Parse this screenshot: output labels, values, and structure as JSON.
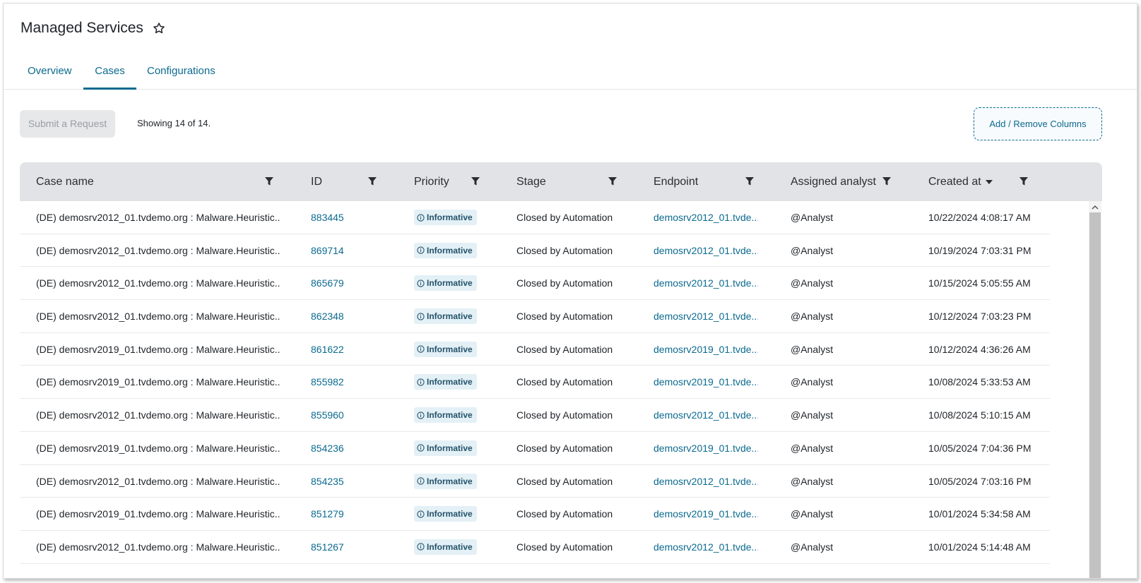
{
  "page": {
    "title": "Managed Services"
  },
  "tabs": [
    {
      "label": "Overview",
      "active": false
    },
    {
      "label": "Cases",
      "active": true
    },
    {
      "label": "Configurations",
      "active": false
    }
  ],
  "toolbar": {
    "submit_label": "Submit a Request",
    "showing_text": "Showing 14 of 14.",
    "add_columns_label": "Add / Remove Columns"
  },
  "table": {
    "columns": [
      "Case name",
      "ID",
      "Priority",
      "Stage",
      "Endpoint",
      "Assigned analyst",
      "Created at"
    ],
    "sorted_column": "Created at",
    "sort_direction": "descending",
    "rows": [
      {
        "name": "(DE) demosrv2012_01.tvdemo.org : Malware.Heuristic....",
        "id": "883445",
        "priority": "Informative",
        "stage": "Closed by Automation",
        "endpoint": "demosrv2012_01.tvde...",
        "analyst": "@Analyst",
        "created": "10/22/2024 4:08:17 AM"
      },
      {
        "name": "(DE) demosrv2012_01.tvdemo.org : Malware.Heuristic....",
        "id": "869714",
        "priority": "Informative",
        "stage": "Closed by Automation",
        "endpoint": "demosrv2012_01.tvde...",
        "analyst": "@Analyst",
        "created": "10/19/2024 7:03:31 PM"
      },
      {
        "name": "(DE) demosrv2012_01.tvdemo.org : Malware.Heuristic....",
        "id": "865679",
        "priority": "Informative",
        "stage": "Closed by Automation",
        "endpoint": "demosrv2012_01.tvde...",
        "analyst": "@Analyst",
        "created": "10/15/2024 5:05:55 AM"
      },
      {
        "name": "(DE) demosrv2012_01.tvdemo.org : Malware.Heuristic....",
        "id": "862348",
        "priority": "Informative",
        "stage": "Closed by Automation",
        "endpoint": "demosrv2012_01.tvde...",
        "analyst": "@Analyst",
        "created": "10/12/2024 7:03:23 PM"
      },
      {
        "name": "(DE) demosrv2019_01.tvdemo.org : Malware.Heuristic....",
        "id": "861622",
        "priority": "Informative",
        "stage": "Closed by Automation",
        "endpoint": "demosrv2019_01.tvde...",
        "analyst": "@Analyst",
        "created": "10/12/2024 4:36:26 AM"
      },
      {
        "name": "(DE) demosrv2019_01.tvdemo.org : Malware.Heuristic....",
        "id": "855982",
        "priority": "Informative",
        "stage": "Closed by Automation",
        "endpoint": "demosrv2019_01.tvde...",
        "analyst": "@Analyst",
        "created": "10/08/2024 5:33:53 AM"
      },
      {
        "name": "(DE) demosrv2012_01.tvdemo.org : Malware.Heuristic....",
        "id": "855960",
        "priority": "Informative",
        "stage": "Closed by Automation",
        "endpoint": "demosrv2012_01.tvde...",
        "analyst": "@Analyst",
        "created": "10/08/2024 5:10:15 AM"
      },
      {
        "name": "(DE) demosrv2019_01.tvdemo.org : Malware.Heuristic....",
        "id": "854236",
        "priority": "Informative",
        "stage": "Closed by Automation",
        "endpoint": "demosrv2019_01.tvde...",
        "analyst": "@Analyst",
        "created": "10/05/2024 7:04:36 PM"
      },
      {
        "name": "(DE) demosrv2012_01.tvdemo.org : Malware.Heuristic....",
        "id": "854235",
        "priority": "Informative",
        "stage": "Closed by Automation",
        "endpoint": "demosrv2012_01.tvde...",
        "analyst": "@Analyst",
        "created": "10/05/2024 7:03:16 PM"
      },
      {
        "name": "(DE) demosrv2019_01.tvdemo.org : Malware.Heuristic....",
        "id": "851279",
        "priority": "Informative",
        "stage": "Closed by Automation",
        "endpoint": "demosrv2019_01.tvde...",
        "analyst": "@Analyst",
        "created": "10/01/2024 5:34:58 AM"
      },
      {
        "name": "(DE) demosrv2012_01.tvdemo.org : Malware.Heuristic....",
        "id": "851267",
        "priority": "Informative",
        "stage": "Closed by Automation",
        "endpoint": "demosrv2012_01.tvde...",
        "analyst": "@Analyst",
        "created": "10/01/2024 5:14:48 AM"
      }
    ]
  },
  "colors": {
    "accent": "#0b6a8f",
    "header_bg": "#e1e3e6",
    "badge_bg": "#e3f0f6"
  },
  "icons": {
    "favorite": "star-outline-icon",
    "filter": "filter-icon",
    "priority": "info-circle-icon",
    "sort": "caret-down-icon"
  }
}
